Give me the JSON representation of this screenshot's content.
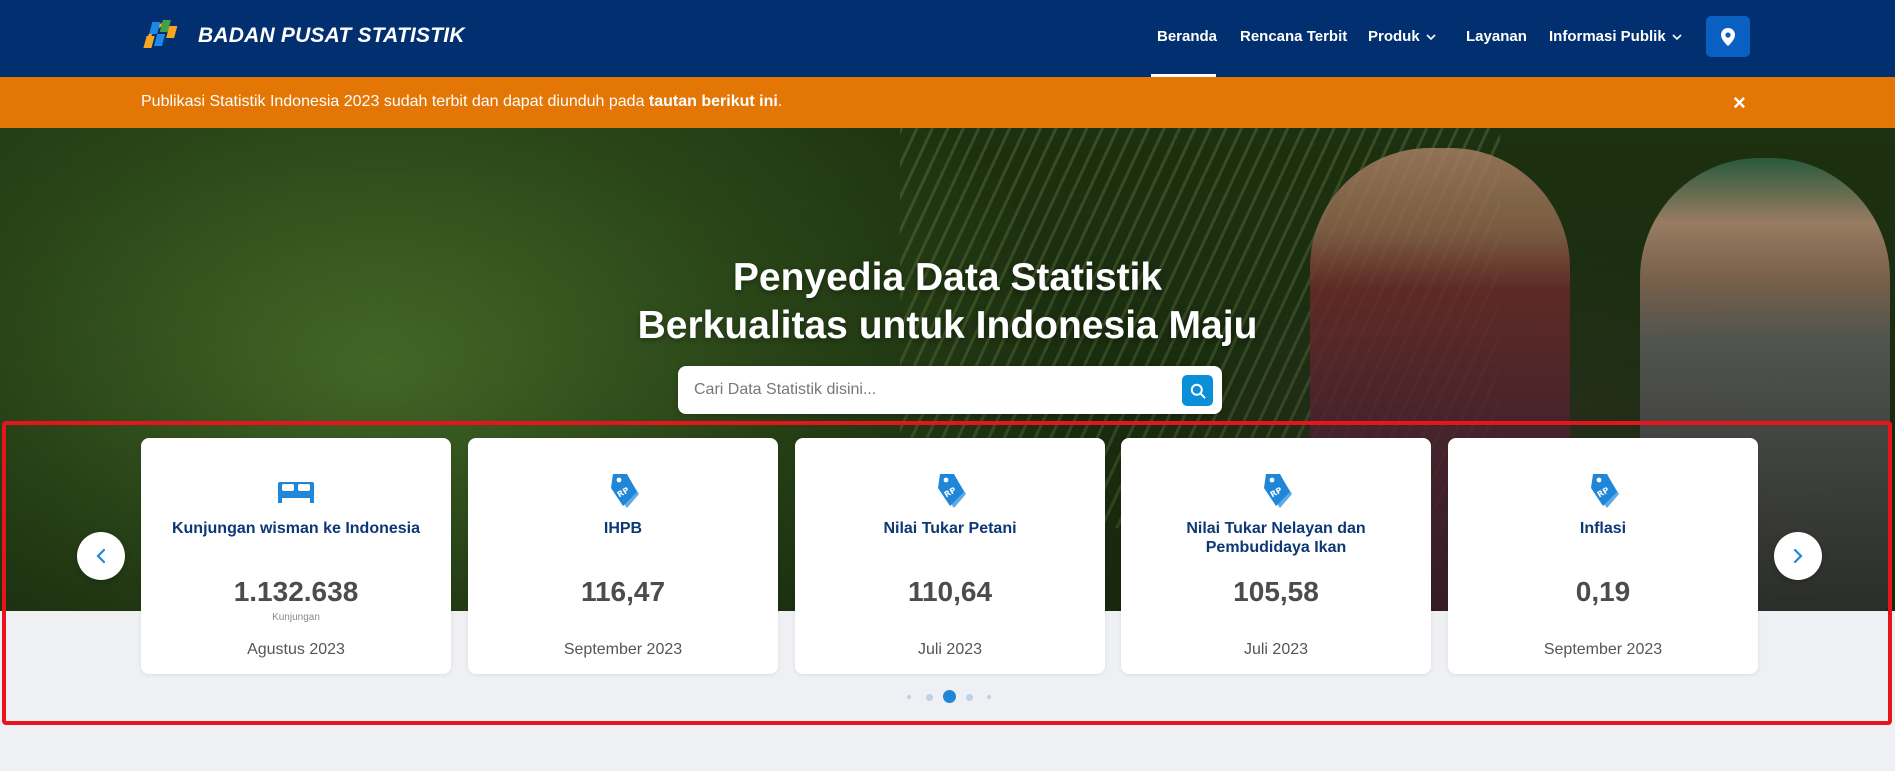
{
  "header": {
    "brand": "BADAN PUSAT STATISTIK",
    "nav": [
      {
        "label": "Beranda",
        "active": true,
        "dropdown": false
      },
      {
        "label": "Rencana Terbit",
        "active": false,
        "dropdown": false
      },
      {
        "label": "Produk",
        "active": false,
        "dropdown": true
      },
      {
        "label": "Layanan",
        "active": false,
        "dropdown": false
      },
      {
        "label": "Informasi Publik",
        "active": false,
        "dropdown": true
      }
    ],
    "location_icon": "map-pin-icon"
  },
  "notice": {
    "text": "Publikasi Statistik Indonesia 2023 sudah terbit dan dapat diunduh pada ",
    "link": "tautan berikut ini",
    "suffix": ".",
    "close": "×"
  },
  "hero": {
    "title_line1": "Penyedia Data Statistik",
    "title_line2": "Berkualitas untuk Indonesia Maju",
    "search_placeholder": "Cari Data Statistik disini..."
  },
  "cards": [
    {
      "icon": "bed-icon",
      "title": "Kunjungan wisman ke Indonesia",
      "value": "1.132.638",
      "unit": "Kunjungan",
      "period": "Agustus 2023"
    },
    {
      "icon": "price-tag-rp-icon",
      "title": "IHPB",
      "value": "116,47",
      "unit": "",
      "period": "September 2023"
    },
    {
      "icon": "price-tag-rp-icon",
      "title": "Nilai Tukar Petani",
      "value": "110,64",
      "unit": "",
      "period": "Juli 2023"
    },
    {
      "icon": "price-tag-rp-icon",
      "title": "Nilai Tukar Nelayan dan Pembudidaya Ikan",
      "value": "105,58",
      "unit": "",
      "period": "Juli 2023"
    },
    {
      "icon": "price-tag-rp-icon",
      "title": "Inflasi",
      "value": "0,19",
      "unit": "",
      "period": "September 2023"
    }
  ],
  "carousel": {
    "dot_count": 5,
    "active_dot": 3
  },
  "colors": {
    "header": "#012f70",
    "notice": "#e47605",
    "accent": "#0a8fd9",
    "card_title": "#0d3775",
    "highlight": "#e8141b"
  }
}
